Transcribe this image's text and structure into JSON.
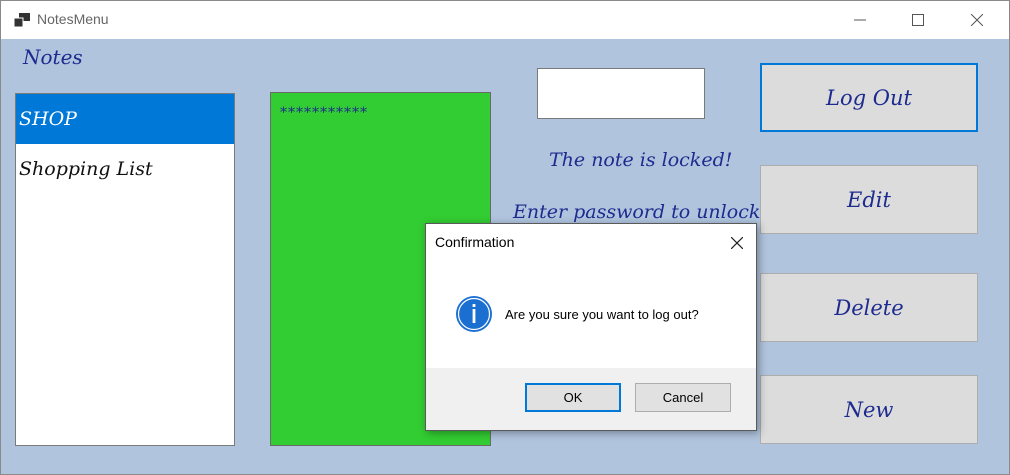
{
  "window": {
    "title": "NotesMenu",
    "icon": "app-window-icon"
  },
  "sidebar": {
    "label": "Notes",
    "items": [
      {
        "label": "SHOP",
        "selected": true
      },
      {
        "label": "Shopping List",
        "selected": false
      }
    ]
  },
  "note": {
    "content": "***********",
    "background": "#32cd32"
  },
  "lock": {
    "password_value": "",
    "locked_message": "The note is locked!",
    "unlock_message": "Enter password to unlock it!"
  },
  "actions": {
    "logout_label": "Log Out",
    "edit_label": "Edit",
    "delete_label": "Delete",
    "new_label": "New"
  },
  "dialog": {
    "title": "Confirmation",
    "icon": "info-icon",
    "message": "Are you sure you want to log out?",
    "ok_label": "OK",
    "cancel_label": "Cancel"
  },
  "colors": {
    "accent": "#0078d7",
    "form_background": "#b0c4de",
    "label_text": "#1d2b8f"
  }
}
